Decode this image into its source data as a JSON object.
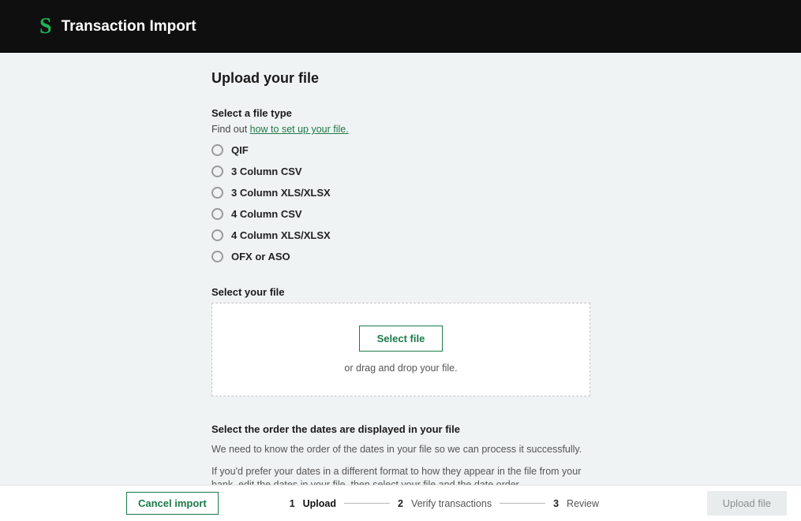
{
  "header": {
    "logo_text": "S",
    "title": "Transaction Import"
  },
  "page_title": "Upload your file",
  "filetype_section": {
    "label": "Select a file type",
    "help_prefix": "Find out ",
    "help_link": "how to set up your file.",
    "options": [
      "QIF",
      "3 Column CSV",
      "3 Column XLS/XLSX",
      "4 Column CSV",
      "4 Column XLS/XLSX",
      "OFX or ASO"
    ]
  },
  "fileselect_section": {
    "label": "Select your file",
    "button": "Select file",
    "hint": "or drag and drop your file."
  },
  "dates_section": {
    "label": "Select the order the dates are displayed in your file",
    "p1": "We need to know the order of the dates in your file so we can process it successfully.",
    "p2": "If you'd prefer your dates in a different format to how they appear in the file from your bank, edit the dates in your file, then select your file and the date order."
  },
  "footer": {
    "cancel": "Cancel import",
    "steps": [
      {
        "num": "1",
        "label": "Upload"
      },
      {
        "num": "2",
        "label": "Verify transactions"
      },
      {
        "num": "3",
        "label": "Review"
      }
    ],
    "upload": "Upload file"
  }
}
